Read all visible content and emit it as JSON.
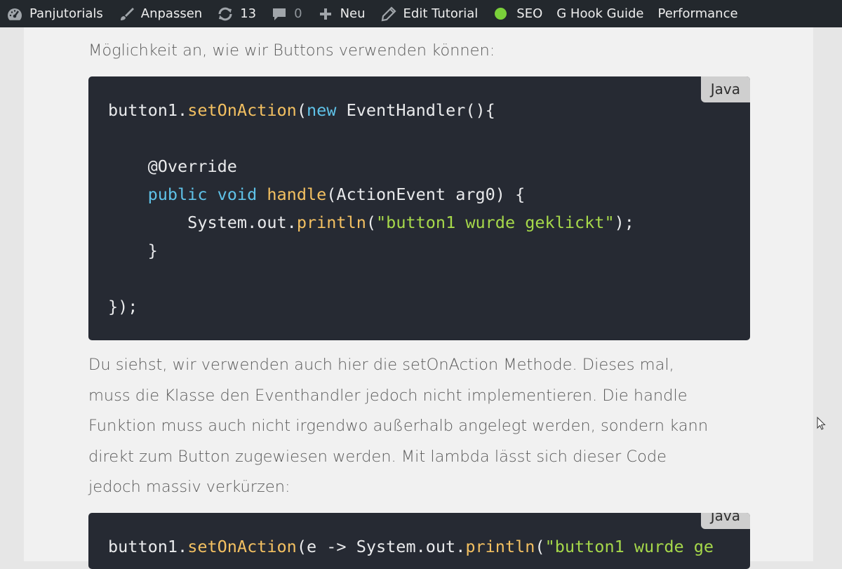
{
  "adminbar": {
    "site_name": "Panjutorials",
    "customize": "Anpassen",
    "updates_count": "13",
    "comments_count": "0",
    "new_label": "Neu",
    "edit_label": "Edit Tutorial",
    "seo_label": "SEO",
    "hook_guide_label": "G Hook Guide",
    "performance_label": "Performance"
  },
  "content": {
    "intro_line": "Möglichkeit an, wie wir Buttons verwenden können:",
    "code1": {
      "lang": "Java",
      "l1_a": "button1.",
      "l1_fn": "setOnAction",
      "l1_b": "(",
      "l1_kw": "new",
      "l1_c": " EventHandler(){",
      "l3": "    @Override",
      "l4_pre": "    ",
      "l4_kw1": "public",
      "l4_sp": " ",
      "l4_kw2": "void",
      "l4_sp2": " ",
      "l4_fn": "handle",
      "l4_rest": "(ActionEvent arg0) {",
      "l5_a": "        System.out.",
      "l5_fn": "println",
      "l5_b": "(",
      "l5_str": "\"button1 wurde geklickt\"",
      "l5_c": ");",
      "l6": "    }",
      "l8": "});"
    },
    "paragraph": [
      "Du siehst, wir verwenden auch hier die setOnAction Methode. Dieses mal,",
      "muss die Klasse den Eventhandler jedoch nicht implementieren. Die handle",
      "Funktion muss auch nicht irgendwo außerhalb angelegt werden, sondern kann",
      "direkt zum Button zugewiesen werden. Mit lambda lässt sich dieser Code",
      "jedoch massiv verkürzen:"
    ],
    "code2": {
      "lang": "Java",
      "l1_a": "button1.",
      "l1_fn": "setOnAction",
      "l1_b": "(e -> System.out.",
      "l1_fn2": "println",
      "l1_c": "(",
      "l1_str": "\"button1 wurde ge"
    }
  },
  "colors": {
    "adminbar_bg": "#23282d",
    "code_bg": "#262a33",
    "method_yellow": "#f3c061",
    "keyword_blue": "#5fc2e8",
    "string_green": "#a6d84a",
    "seo_status": "#7ad03a"
  },
  "icons": [
    "dashboard-icon",
    "paintbrush-icon",
    "updates-icon",
    "comment-icon",
    "plus-icon",
    "pencil-icon",
    "seo-status-dot",
    "mouse-cursor-icon"
  ]
}
